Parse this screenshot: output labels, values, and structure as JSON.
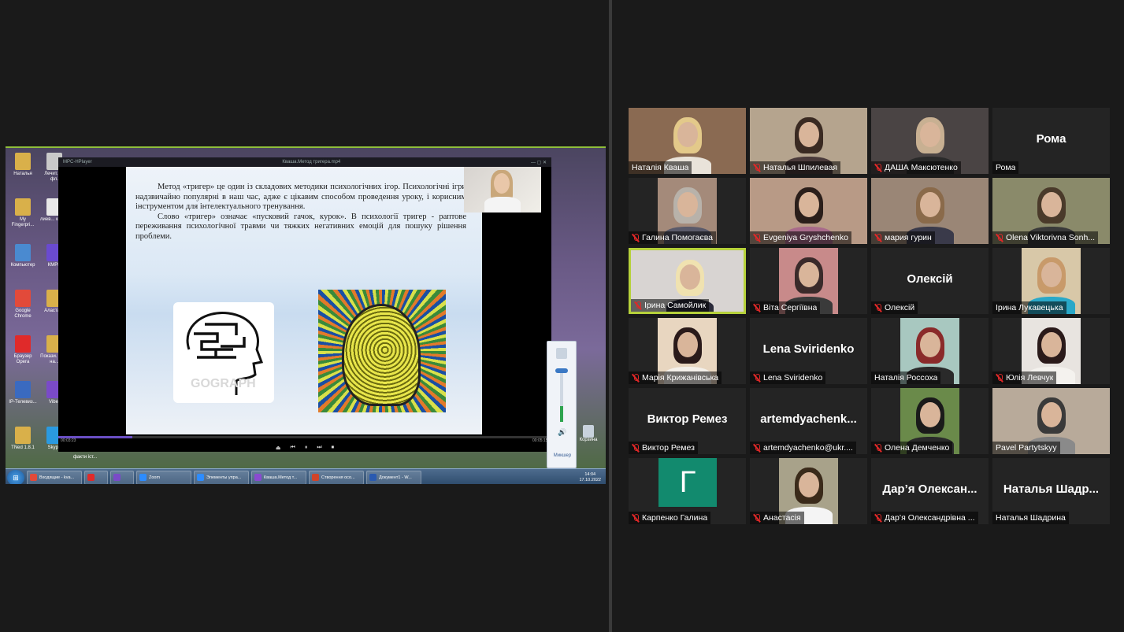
{
  "shared_screen": {
    "player_title": "Кваша.Метод тригера.mp4",
    "player_app": "MPC-HPlayer",
    "slide": {
      "paragraph1": "Метод «тригер» це один із складових методики психологічних ігор. Психологічні ігри надзвичайно популярні в наш час, адже є цікавим способом проведення уроку, і корисним інструментом для інтелектуального тренування.",
      "paragraph2": "Слово «тригер» означає «пусковий гачок, курок». В психології тригер - раптове переживання психологічної травми чи тяжких негативних емоцій для пошуку рішення проблеми.",
      "watermark": "GOGRAPH"
    },
    "time_elapsed": "00:03:23",
    "time_total": "00:05:15",
    "progress_percent": 15,
    "desktop_icons": [
      {
        "label": "Наталья",
        "icon": "folder-icon",
        "color": "#d9b04a"
      },
      {
        "label": "Лечит. на фл.",
        "icon": "usb-icon",
        "color": "#c9c9c9"
      },
      {
        "label": "My Fingerpri...",
        "icon": "folder-icon",
        "color": "#d9b04a"
      },
      {
        "label": "лиев... кабі...",
        "icon": "document-icon",
        "color": "#e8e8e8"
      },
      {
        "label": "Компьютер",
        "icon": "computer-icon",
        "color": "#4a8ad0"
      },
      {
        "label": "КМРБ",
        "icon": "app-icon",
        "color": "#6a4ad0"
      },
      {
        "label": "Google Chrome",
        "icon": "chrome-icon",
        "color": "#e24a3a"
      },
      {
        "label": "Аластасі.",
        "icon": "folder-icon",
        "color": "#d9b04a"
      },
      {
        "label": "Браузер Opera",
        "icon": "opera-icon",
        "color": "#e02a2a"
      },
      {
        "label": "Покази. ЗНО на...",
        "icon": "folder-icon",
        "color": "#d9b04a"
      },
      {
        "label": "IP-Телевиз...",
        "icon": "tv-icon",
        "color": "#3a6ac0"
      },
      {
        "label": "Viber",
        "icon": "viber-icon",
        "color": "#7a4ac8"
      },
      {
        "label": "TNed 1.8.1",
        "icon": "folder-icon",
        "color": "#d9b04a"
      },
      {
        "label": "Skype",
        "icon": "skype-icon",
        "color": "#2a9ae0"
      }
    ],
    "desktop_extra_label": "факти іст...",
    "recycle_label": "Корзина",
    "mixer_label": "Микшер",
    "taskbar": {
      "items": [
        {
          "label": "Входящие - kva...",
          "icon": "chrome-icon",
          "color": "#e24a3a"
        },
        {
          "label": "",
          "icon": "opera-icon",
          "color": "#e02a2a"
        },
        {
          "label": "",
          "icon": "viber-icon",
          "color": "#7a4ac8"
        },
        {
          "label": "Zoom",
          "icon": "zoom-icon",
          "color": "#2d8cff"
        },
        {
          "label": "Элементы упра...",
          "icon": "zoom-icon",
          "color": "#2d8cff"
        },
        {
          "label": "Кваша.Метод т...",
          "icon": "player-icon",
          "color": "#8a4ad0"
        },
        {
          "label": "Створення осо...",
          "icon": "powerpoint-icon",
          "color": "#d0442a"
        },
        {
          "label": "Документ1 - W...",
          "icon": "word-icon",
          "color": "#2a5ab0"
        }
      ],
      "clock_time": "14:04",
      "clock_date": "17.10.2022"
    }
  },
  "gallery": {
    "participants": [
      {
        "name": "Наталія Кваша",
        "display": "video",
        "muted": false,
        "active": false,
        "bg": "#8a6a52",
        "hair": "#e3c98a",
        "torso": "#e9e3da"
      },
      {
        "name": "Наталья Шпилевая",
        "display": "video",
        "muted": true,
        "active": false,
        "bg": "#b5a48e",
        "hair": "#3a2a22",
        "torso": "#4a3a3a"
      },
      {
        "name": "ДАША Максютенко",
        "display": "video",
        "muted": true,
        "active": false,
        "bg": "#4a4444",
        "hair": "#c8b092",
        "torso": "#2a2a2a"
      },
      {
        "name": "Рома",
        "display": "name",
        "big_name": "Рома",
        "muted": false,
        "active": false
      },
      {
        "name": "Галина Помогаєва",
        "display": "video",
        "muted": true,
        "active": false,
        "bg": "#a48a7a",
        "hair": "#b8b2aa",
        "torso": "#5a5a6a",
        "narrow": true
      },
      {
        "name": "Evgeniya Gryshchenko",
        "display": "video",
        "muted": true,
        "active": false,
        "bg": "#b89a86",
        "hair": "#2a1e1a",
        "torso": "#a86a8a"
      },
      {
        "name": "мария гурин",
        "display": "video",
        "muted": true,
        "active": false,
        "bg": "#9a8676",
        "hair": "#8a6a4a",
        "torso": "#3a3a4a"
      },
      {
        "name": "Olena Viktorivna Sonh...",
        "display": "video",
        "muted": true,
        "active": false,
        "bg": "#8a8a6a",
        "hair": "#4a3a2a",
        "torso": "#3a3a3a"
      },
      {
        "name": "Ірина Самойлик",
        "display": "video",
        "muted": true,
        "active": true,
        "bg": "#d8d4d2",
        "hair": "#f0e2b0",
        "torso": "#2a2a3a"
      },
      {
        "name": "Віта Сергіївна",
        "display": "video",
        "muted": true,
        "active": false,
        "bg": "#c88a8a",
        "hair": "#3a2a2a",
        "torso": "#3a3a3a",
        "narrow": true
      },
      {
        "name": "Олексій",
        "display": "name",
        "big_name": "Олексій",
        "muted": true,
        "active": false
      },
      {
        "name": "Ірина Лукавецька",
        "display": "video",
        "muted": false,
        "active": false,
        "bg": "#d8c8a8",
        "hair": "#c89a6a",
        "torso": "#2aa8c8",
        "narrow": true
      },
      {
        "name": "Марія Крижанівська",
        "display": "video",
        "muted": true,
        "active": false,
        "bg": "#e8d6c0",
        "hair": "#2a1a1a",
        "torso": "#f4f0ea",
        "narrow": true
      },
      {
        "name": "Lena Sviridenko",
        "display": "name",
        "big_name": "Lena Sviridenko",
        "muted": true,
        "active": false
      },
      {
        "name": "Наталія Россоха",
        "display": "video",
        "muted": false,
        "active": false,
        "bg": "#a8c8c0",
        "hair": "#8a2a2a",
        "torso": "#2a2a2a",
        "narrow": true
      },
      {
        "name": "Юлія Левчук",
        "display": "video",
        "muted": true,
        "active": false,
        "bg": "#e8e4e0",
        "hair": "#2a1a1a",
        "torso": "#f4f2ee",
        "narrow": true
      },
      {
        "name": "Виктор Ремез",
        "display": "name",
        "big_name": "Виктор Ремез",
        "muted": true,
        "active": false
      },
      {
        "name": "artemdyachenko@ukr....",
        "display": "name",
        "big_name": "artemdyachenk...",
        "muted": true,
        "active": false
      },
      {
        "name": "Олена Демченко",
        "display": "video",
        "muted": true,
        "active": false,
        "bg": "#6a8a4a",
        "hair": "#1a1a1a",
        "torso": "#2a2a2a",
        "narrow": true
      },
      {
        "name": "Pavel Partytskyy",
        "display": "video",
        "muted": false,
        "active": false,
        "bg": "#b8aa9a",
        "hair": "#3a3a3a",
        "torso": "#8a8a8a"
      },
      {
        "name": "Карпенко Галина",
        "display": "avatar",
        "avatar_letter": "Г",
        "muted": true,
        "active": false
      },
      {
        "name": "Анастасія",
        "display": "video",
        "muted": true,
        "active": false,
        "bg": "#a8a28a",
        "hair": "#3a2a1a",
        "torso": "#f4f4f4",
        "narrow": true
      },
      {
        "name": "Дар’я Олександрівна ...",
        "display": "name",
        "big_name": "Дар’я Олексан...",
        "muted": true,
        "active": false
      },
      {
        "name": "Наталья Шадрина",
        "display": "name",
        "big_name": "Наталья Шадр...",
        "muted": false,
        "active": false
      }
    ]
  }
}
